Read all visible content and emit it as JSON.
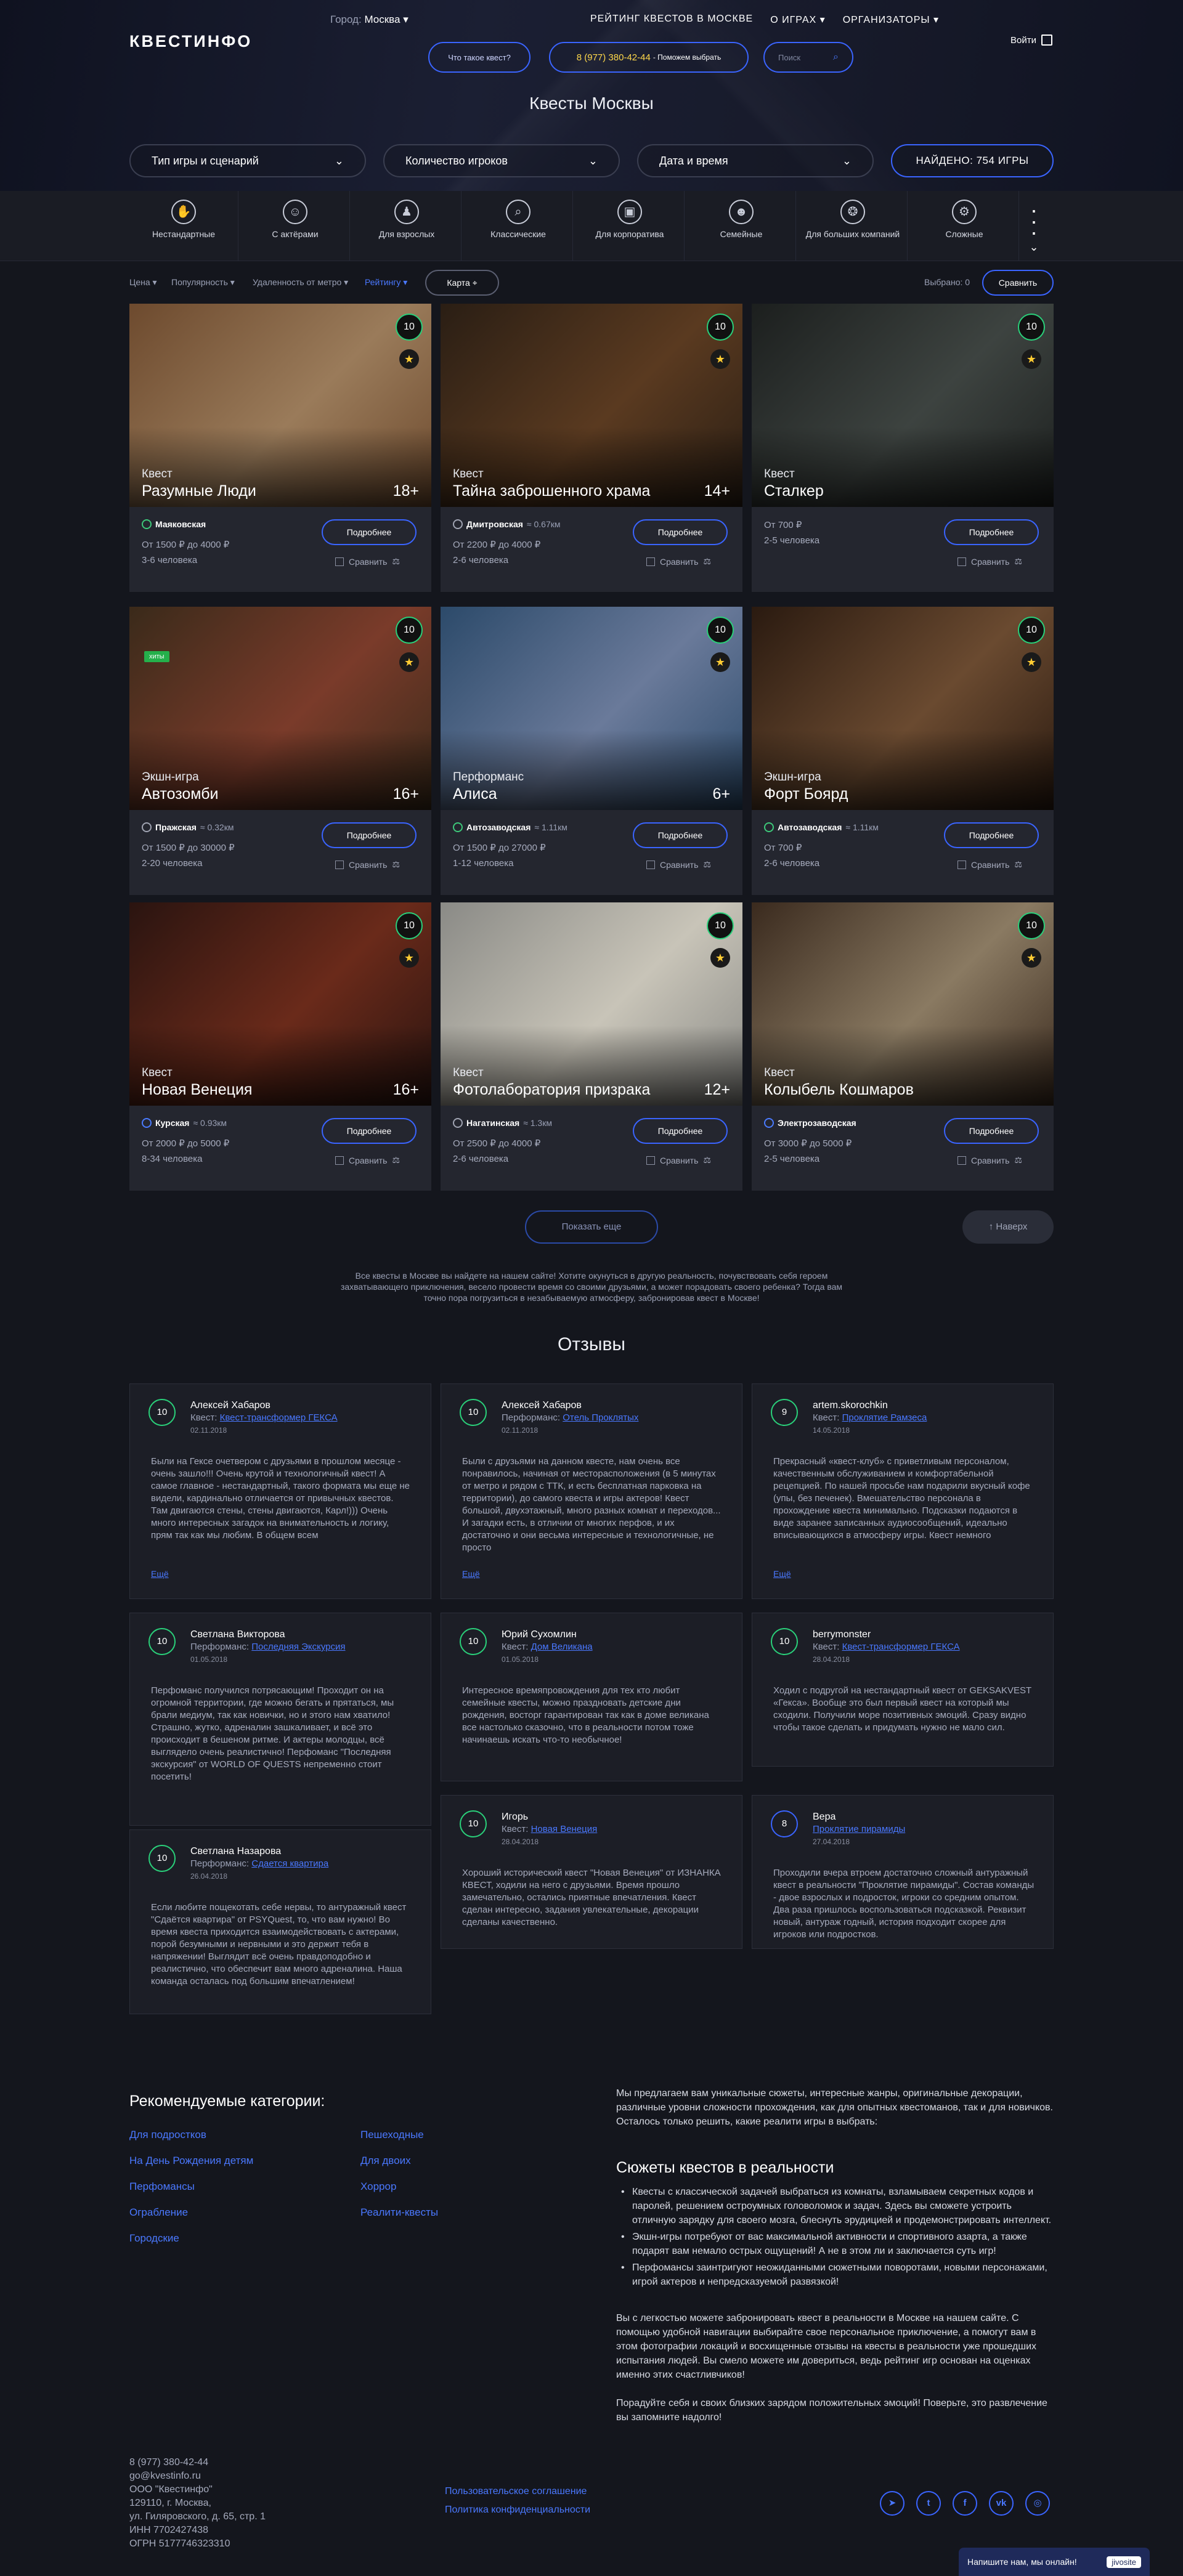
{
  "header": {
    "logo": "КВЕСТИНФО",
    "city_label": "Город:",
    "city_value": "Москва ▾",
    "nav": [
      "РЕЙТИНГ КВЕСТОВ В МОСКВЕ",
      "О ИГРАХ ▾",
      "ОРГАНИЗАТОРЫ ▾"
    ],
    "what_is_quest": "Что такое квест?",
    "phone": "8 (977) 380-42-44",
    "phone_hint": "- Поможем выбрать",
    "search_placeholder": "Поиск",
    "login": "Войти",
    "page_title": "Квесты Москвы"
  },
  "filters": {
    "type": "Тип игры и сценарий",
    "players": "Количество игроков",
    "datetime": "Дата и время",
    "found": "НАЙДЕНО: 754 ИГРЫ"
  },
  "categories": [
    {
      "label": "Нестандартные",
      "icon": "hand-icon",
      "glyph": "✋"
    },
    {
      "label": "С актёрами",
      "icon": "masks-icon",
      "glyph": "☺"
    },
    {
      "label": "Для взрослых",
      "icon": "people-icon",
      "glyph": "♟"
    },
    {
      "label": "Классические",
      "icon": "magnifier-icon",
      "glyph": "⌕"
    },
    {
      "label": "Для корпоратива",
      "icon": "briefcase-icon",
      "glyph": "▣"
    },
    {
      "label": "Семейные",
      "icon": "family-icon",
      "glyph": "☻"
    },
    {
      "label": "Для больших компаний",
      "icon": "group-icon",
      "glyph": "❂"
    },
    {
      "label": "Сложные",
      "icon": "gears-icon",
      "glyph": "⚙"
    }
  ],
  "sort": {
    "price": "Цена ▾",
    "popular": "Популярность ▾",
    "metro": "Удаленность от метро ▾",
    "rating": "Рейтингу ▾",
    "map": "Карта ⌖",
    "chosen": "Выбрано: 0",
    "compare": "Сравнить"
  },
  "card_labels": {
    "more": "Подробнее",
    "compare": "Сравнить"
  },
  "cards": [
    {
      "genre": "Квест",
      "name": "Разумные Люди",
      "age": "18+",
      "rating": "10",
      "metro": "Маяковская",
      "dist": "",
      "line": "green",
      "price": "От 1500 ₽ до 4000 ₽",
      "players": "3-6 человека",
      "badge": "",
      "color1": "#6d4a2e",
      "color2": "#9a7b5a"
    },
    {
      "genre": "Квест",
      "name": "Тайна заброшенного храма",
      "age": "14+",
      "rating": "10",
      "metro": "Дмитровская",
      "dist": "≈ 0.67км",
      "line": "grey",
      "price": "От 2200 ₽ до 4000 ₽",
      "players": "2-6 человека",
      "badge": "",
      "color1": "#2a1e14",
      "color2": "#5a3a20"
    },
    {
      "genre": "Квест",
      "name": "Сталкер",
      "age": "",
      "rating": "10",
      "metro": "",
      "dist": "",
      "line": "",
      "price": "От 700 ₽",
      "players": "2-5 человека",
      "badge": "",
      "color1": "#1c1f1e",
      "color2": "#3d4340"
    },
    {
      "genre": "Экшн-игра",
      "name": "Автозомби",
      "age": "16+",
      "rating": "10",
      "metro": "Пражская",
      "dist": "≈ 0.32км",
      "line": "grey",
      "price": "От 1500 ₽ до 30000 ₽",
      "players": "2-20 человека",
      "badge": "хиты",
      "color1": "#3a2a1a",
      "color2": "#7a3b2a"
    },
    {
      "genre": "Перформанс",
      "name": "Алиса",
      "age": "6+",
      "rating": "10",
      "metro": "Автозаводская",
      "dist": "≈ 1.11км",
      "line": "green",
      "price": "От 1500 ₽ до 27000 ₽",
      "players": "1-12 человека",
      "badge": "",
      "color1": "#2c4a6a",
      "color2": "#6a7a9a"
    },
    {
      "genre": "Экшн-игра",
      "name": "Форт Боярд",
      "age": "",
      "rating": "10",
      "metro": "Автозаводская",
      "dist": "≈ 1.11км",
      "line": "green",
      "price": "От 700 ₽",
      "players": "2-6 человека",
      "badge": "",
      "color1": "#2a1a10",
      "color2": "#6a4a30"
    },
    {
      "genre": "Квест",
      "name": "Новая Венеция",
      "age": "16+",
      "rating": "10",
      "metro": "Курская",
      "dist": "≈ 0.93км",
      "line": "blue",
      "price": "От 2000 ₽ до 5000 ₽",
      "players": "8-34 человека",
      "badge": "",
      "color1": "#2a1410",
      "color2": "#6a2a1a"
    },
    {
      "genre": "Квест",
      "name": "Фотолаборатория призрака",
      "age": "12+",
      "rating": "10",
      "metro": "Нагатинская",
      "dist": "≈ 1.3км",
      "line": "grey",
      "price": "От 2500 ₽ до 4000 ₽",
      "players": "2-6 человека",
      "badge": "",
      "color1": "#8a8a86",
      "color2": "#c8c4b8"
    },
    {
      "genre": "Квест",
      "name": "Колыбель Кошмаров",
      "age": "",
      "rating": "10",
      "metro": "Электрозаводская",
      "dist": "",
      "line": "blue",
      "price": "От 3000 ₽ до 5000 ₽",
      "players": "2-5 человека",
      "badge": "",
      "color1": "#3a2a1e",
      "color2": "#8a7a62"
    }
  ],
  "load_more": "Показать еще",
  "to_top": "↑   Наверх",
  "seo_text": "Все квесты в Москве вы найдете на нашем сайте! Хотите окунуться в другую реальность, почувствовать себя героем захватывающего приключения, весело провести время со своими друзьями, а может порадовать своего ребенка? Тогда вам точно пора погрузиться в незабываемую атмосферу, забронировав квест в Москве!",
  "reviews_title": "Отзывы",
  "reviews_more": "Ещё",
  "reviews": [
    {
      "rating": "10",
      "author": "Алексей Хабаров",
      "kind": "Квест:",
      "quest": "Квест-трансформер ГЕКСА",
      "date": "02.11.2018",
      "text": "Были на Гексе очетвером с друзьями в прошлом месяце - очень зашло!!! Очень крутой и технологичный квест! А самое главное - нестандартный, такого формата мы еще не видели, кардинально отличается от привычных квестов. Там двигаются стены, стены двигаются, Карл!))) Очень много интересных загадок на внимательность и логику, прям так как мы любим. В общем всем",
      "more": true
    },
    {
      "rating": "10",
      "author": "Алексей Хабаров",
      "kind": "Перформанс:",
      "quest": "Отель Проклятых",
      "date": "02.11.2018",
      "text": "Были с друзьями на данном квесте, нам очень все понравилось, начиная от месторасположения (в 5 минутах от метро и рядом с ТТК, и есть бесплатная парковка на территории), до самого квеста и игры актеров! Квест большой, двухэтажный, много разных комнат и переходов... И загадки есть, в отличии от многих перфов, и их достаточно и они весьма интересные и технологичные, не просто",
      "more": true
    },
    {
      "rating": "9",
      "author": "artem.skorochkin",
      "kind": "Квест:",
      "quest": "Проклятие Рамзеса",
      "date": "14.05.2018",
      "text": "Прекрасный «квест-клуб» с приветливым персоналом, качественным обслуживанием и комфортабельной рецепцией. По нашей просьбе нам подарили вкусный кофе (упы, без печенек). Вмешательство персонала в прохождение квеста минимально. Подсказки подаются в виде заранее записанных аудиосообщений, идеально вписывающихся в атмосферу игры. Квест немного",
      "more": true
    },
    {
      "rating": "10",
      "author": "Светлана Викторова",
      "kind": "Перформанс:",
      "quest": "Последняя Экскурсия",
      "date": "01.05.2018",
      "text": "Перфоманс получился потрясающим! Проходит он на огромной территории, где можно бегать и прятаться, мы брали медиум, так как новички, но и этого нам хватило! Страшно, жутко, адреналин зашкаливает, и всё это происходит в бешеном ритме. И актеры молодцы, всё выглядело очень реалистично! Перфоманс \"Последняя экскурсия\" от WORLD OF QUESTS непременно стоит посетить!",
      "more": false
    },
    {
      "rating": "10",
      "author": "Юрий Сухомлин",
      "kind": "Квест:",
      "quest": "Дом Великана",
      "date": "01.05.2018",
      "text": "Интересное времяпровождения для тех кто любит семейные квесты, можно праздновать детские дни рождения, восторг гарантирован так как в доме великана все настолько сказочно, что в реальности потом тоже начинаешь искать что-то необычное!",
      "more": false
    },
    {
      "rating": "10",
      "author": "berrymonster",
      "kind": "Квест:",
      "quest": "Квест-трансформер ГЕКСА",
      "date": "28.04.2018",
      "text": "Ходил с подругой на нестандартный квест от GEKSAKVEST «Гекса». Вообще это был первый квест на который мы сходили. Получили море позитивных эмоций. Сразу видно чтобы такое сделать и придумать нужно не мало сил.",
      "more": false
    },
    {
      "rating": "10",
      "author": "Светлана Назарова",
      "kind": "Перформанс:",
      "quest": "Сдается квартира",
      "date": "26.04.2018",
      "text": "Если любите пощекотать себе нервы, то антуражный квест \"Сдаётся квартира\" от PSYQuest, то, что вам нужно! Во время квеста приходится взаимодействовать с актерами, порой безумными и нервными и это держит тебя в напряжении! Выглядит всё очень правдоподобно и реалистично, что обеспечит вам много адреналина. Наша команда осталась под большим впечатлением!",
      "more": false
    },
    {
      "rating": "10",
      "author": "Игорь",
      "kind": "Квест:",
      "quest": "Новая Венеция",
      "date": "28.04.2018",
      "text": "Хороший исторический квест \"Новая Венеция\" от ИЗНАНКА КВЕСТ, ходили на него с друзьями. Время прошло замечательно, остались приятные впечатления. Квест сделан интересно, задания увлекательные, декорации сделаны качественно.",
      "more": false
    },
    {
      "rating": "8",
      "author": "Вера",
      "kind": "",
      "quest": "Проклятие пирамиды",
      "date": "27.04.2018",
      "text": "Проходили вчера втроем достаточно сложный антуражный квест в реальности \"Проклятие пирамиды\". Состав команды - двое взрослых и подросток, игроки со средним опытом. Два раза пришлось воспользоваться подсказкой. Реквизит новый, антураж годный, история подходит скорее для игроков или подростков.",
      "more": false
    }
  ],
  "recommended": {
    "title": "Рекомендуемые категории:",
    "col1": [
      "Для подростков",
      "На День Рождения детям",
      "Перфомансы",
      "Ограбление",
      "Городские"
    ],
    "col2": [
      "Пешеходные",
      "Для двоих",
      "Хоррор",
      "Реалити-квесты"
    ]
  },
  "about": {
    "intro": "Мы предлагаем вам уникальные сюжеты, интересные жанры, оригинальные декорации, различные уровни сложности прохождения, как для опытных квестоманов, так и для новичков. Осталось только решить, какие реалити игры в выбрать:",
    "heading": "Сюжеты квестов в реальности",
    "bullets": [
      "Квесты с классической задачей выбраться из комнаты, взламываем секретных кодов и паролей, решением остроумных головоломок и задач. Здесь вы сможете устроить отличную зарядку для своего мозга, блеснуть эрудицией и продемонстрировать интеллект.",
      "Экшн-игры потребуют от вас максимальной активности и спортивного азарта, а также подарят вам немало острых ощущений! А не в этом ли и заключается суть игр!",
      "Перфомансы заинтригуют неожиданными сюжетными поворотами, новыми персонажами, игрой актеров и непредсказуемой развязкой!"
    ],
    "para2": "Вы с легкостью можете забронировать квест в реальности в Москве на нашем сайте. С помощью удобной навигации выбирайте свое персональное приключение, а помогут вам в этом фотографии локаций и восхищенные отзывы на квесты в реальности уже прошедших испытания людей. Вы смело можете им довериться, ведь рейтинг игр основан на оценках именно этих счастливчиков!",
    "para3": "Порадуйте себя и своих близких зарядом положительных эмоций! Поверьте, это развлечение вы запомните надолго!"
  },
  "footer": {
    "contacts": [
      "8 (977) 380-42-44",
      "go@kvestinfo.ru",
      "ООО \"Квестинфо\"",
      "129110, г. Москва,",
      "ул. Гиляровского, д. 65, стр. 1",
      "ИНН 7702427438",
      "ОГРН 5177746323310"
    ],
    "agreement": "Пользовательское соглашение",
    "privacy": "Политика конфиденциальности",
    "social": [
      {
        "icon": "telegram-icon",
        "glyph": "➤"
      },
      {
        "icon": "twitter-icon",
        "glyph": "t"
      },
      {
        "icon": "facebook-icon",
        "glyph": "f"
      },
      {
        "icon": "vk-icon",
        "glyph": "vk"
      },
      {
        "icon": "instagram-icon",
        "glyph": "◎"
      }
    ]
  },
  "chat": {
    "label": "Напишите нам, мы онлайн!",
    "brand": "jivosite"
  },
  "colors": {
    "accent": "#3a64ff",
    "rating_ring": "#2ad07a",
    "link": "#4a78ff",
    "bg": "#14161d"
  }
}
